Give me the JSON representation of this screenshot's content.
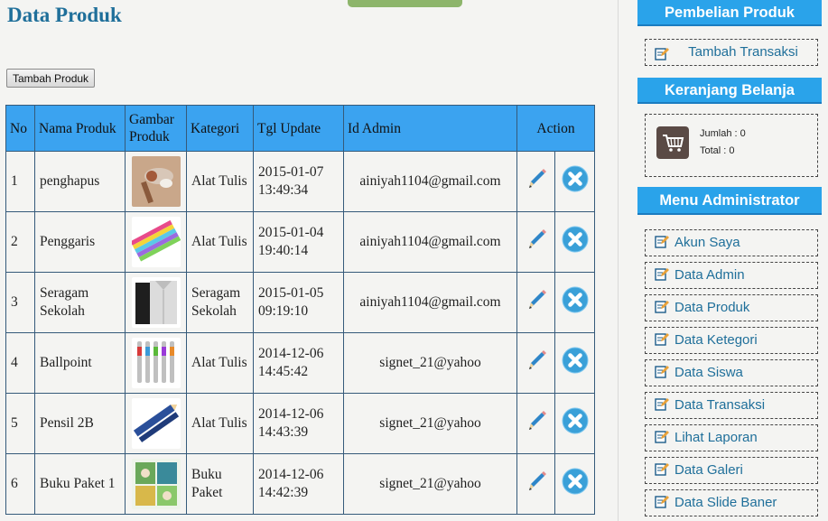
{
  "header": {
    "title": "Data Produk"
  },
  "toolbar": {
    "add_label": "Tambah Produk"
  },
  "table": {
    "headers": {
      "no": "No",
      "nama": "Nama Produk",
      "gambar": "Gambar Produk",
      "kategori": "Kategori",
      "tgl": "Tgl Update",
      "admin": "Id Admin",
      "action": "Action"
    },
    "rows": [
      {
        "no": "1",
        "nama": "penghapus",
        "kategori": "Alat Tulis",
        "tgl": "2015-01-07 13:49:34",
        "admin": "ainiyah1104@gmail.com"
      },
      {
        "no": "2",
        "nama": "Penggaris",
        "kategori": "Alat Tulis",
        "tgl": "2015-01-04 19:40:14",
        "admin": "ainiyah1104@gmail.com"
      },
      {
        "no": "3",
        "nama": "Seragam Sekolah",
        "kategori": "Seragam Sekolah",
        "tgl": "2015-01-05 09:19:10",
        "admin": "ainiyah1104@gmail.com"
      },
      {
        "no": "4",
        "nama": "Ballpoint",
        "kategori": "Alat Tulis",
        "tgl": "2014-12-06 14:45:42",
        "admin": "signet_21@yahoo"
      },
      {
        "no": "5",
        "nama": "Pensil 2B",
        "kategori": "Alat Tulis",
        "tgl": "2014-12-06 14:43:39",
        "admin": "signet_21@yahoo"
      },
      {
        "no": "6",
        "nama": "Buku Paket 1",
        "kategori": "Buku Paket",
        "tgl": "2014-12-06 14:42:39",
        "admin": "signet_21@yahoo"
      }
    ]
  },
  "sidebar": {
    "pembelian": {
      "title": "Pembelian Produk",
      "link": "Tambah Transaksi"
    },
    "keranjang": {
      "title": "Keranjang Belanja",
      "jumlah": "Jumlah : 0",
      "total": "Total : 0"
    },
    "admin_menu": {
      "title": "Menu Administrator",
      "items": [
        "Akun Saya",
        "Data Admin",
        "Data Produk",
        "Data Ketegori",
        "Data Siswa",
        "Data Transaksi",
        "Lihat Laporan",
        "Data Galeri",
        "Data Slide Baner"
      ]
    }
  },
  "colors": {
    "header_bg": "#3ba3f0",
    "sidebar_head": "#2aa3ea",
    "title": "#1f6f9a",
    "delete_icon": "#3aa0d8"
  },
  "icons": {
    "edit": "pencil-icon",
    "delete": "delete-circle-icon",
    "menu": "edit-note-icon",
    "cart": "cart-icon"
  }
}
